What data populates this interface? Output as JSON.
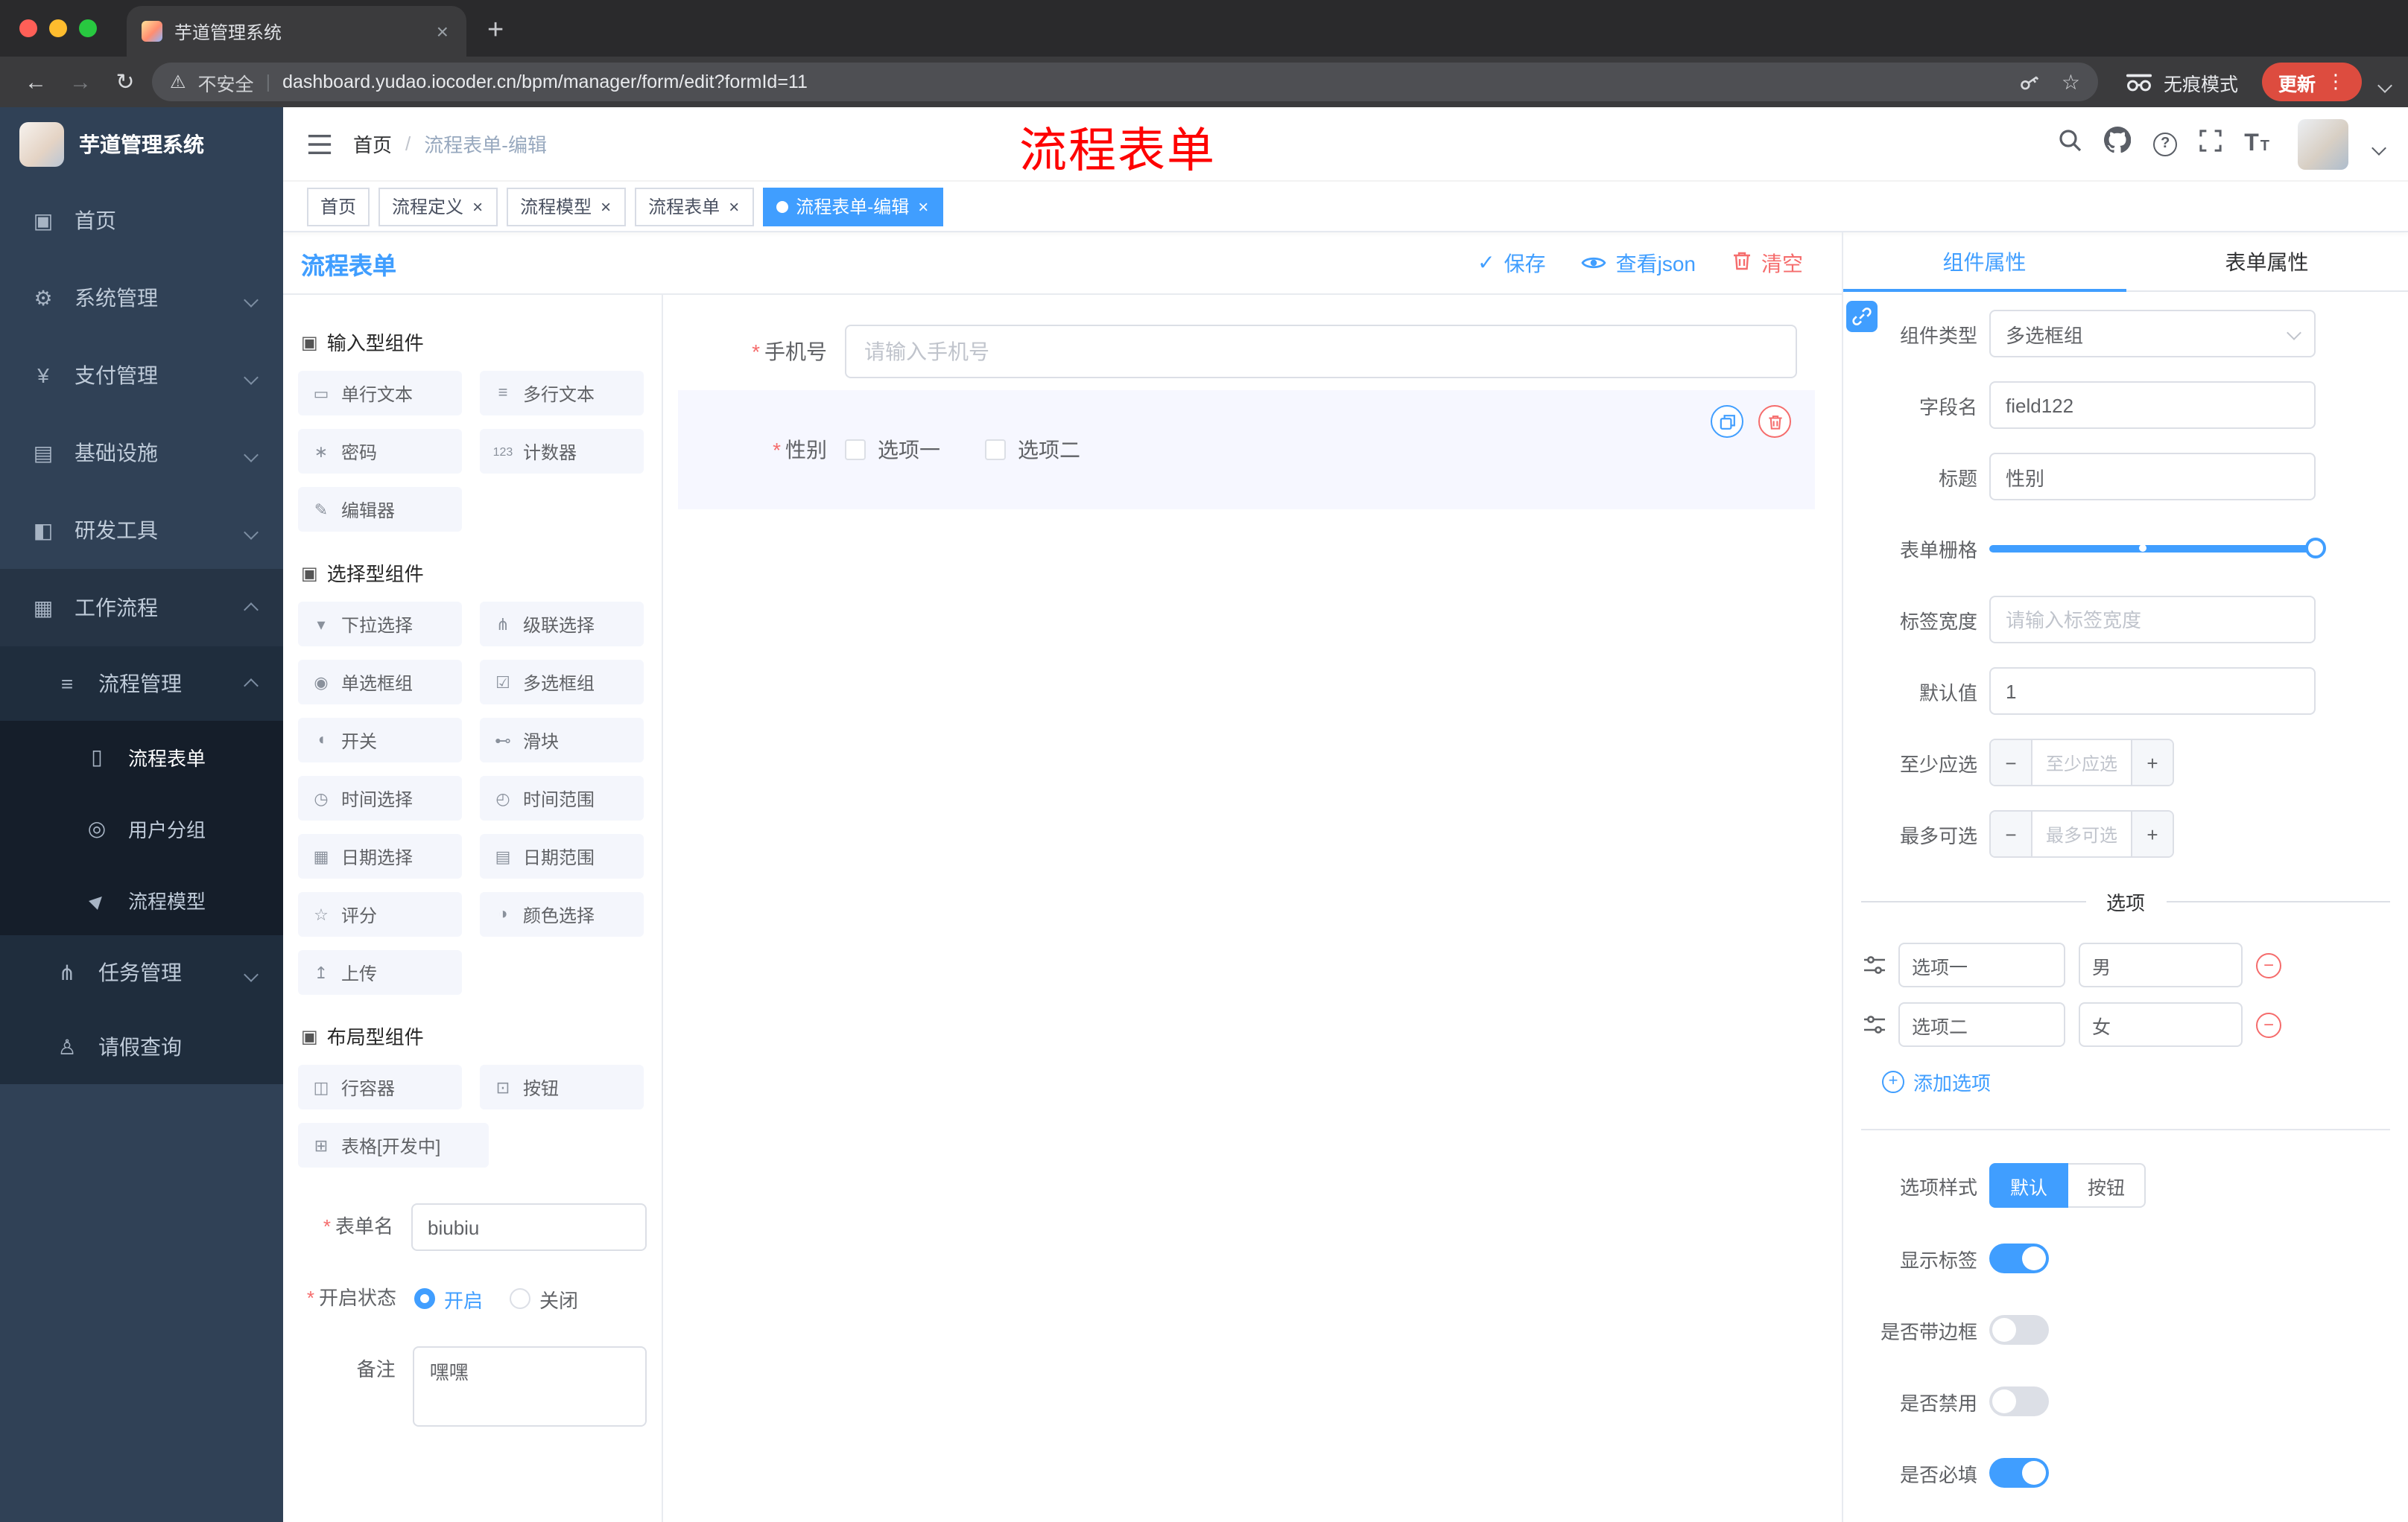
{
  "browser": {
    "tab_title": "芋道管理系统",
    "security_label": "不安全",
    "url": "dashboard.yudao.iocoder.cn/bpm/manager/form/edit?formId=11",
    "incognito_label": "无痕模式",
    "update_label": "更新"
  },
  "icons": {
    "close": "×",
    "new_tab": "+",
    "back": "←",
    "forward": "→",
    "reload": "↻",
    "warning": "⚠",
    "url_divider": "|",
    "star": "☆",
    "kebab": "⋮",
    "question": "?",
    "breadcrumb_sep": "/",
    "check": "✓",
    "required": "*",
    "minus": "−",
    "plus": "+",
    "t_large": "T",
    "t_small": "T"
  },
  "sidebar": {
    "title": "芋道管理系统",
    "items": [
      {
        "icon": "▣",
        "label": "首页"
      },
      {
        "icon": "⚙",
        "label": "系统管理"
      },
      {
        "icon": "¥",
        "label": "支付管理"
      },
      {
        "icon": "▤",
        "label": "基础设施"
      },
      {
        "icon": "◧",
        "label": "研发工具"
      },
      {
        "icon": "▦",
        "label": "工作流程"
      }
    ],
    "process_group": {
      "icon": "≡",
      "label": "流程管理"
    },
    "process_children": [
      {
        "icon": "▯",
        "label": "流程表单"
      },
      {
        "icon": "◎",
        "label": "用户分组"
      },
      {
        "icon": "▶",
        "label": "流程模型"
      }
    ],
    "task_item": {
      "icon": "⋔",
      "label": "任务管理"
    },
    "leave_item": {
      "icon": "♙",
      "label": "请假查询"
    }
  },
  "header": {
    "breadcrumb": [
      "首页",
      "流程表单-编辑"
    ],
    "annotation": "流程表单"
  },
  "tags": [
    {
      "label": "首页"
    },
    {
      "label": "流程定义"
    },
    {
      "label": "流程模型"
    },
    {
      "label": "流程表单"
    },
    {
      "label": "流程表单-编辑"
    }
  ],
  "builder": {
    "title": "流程表单",
    "save": "保存",
    "view_json": "查看json",
    "clear": "清空"
  },
  "palette": {
    "groups": [
      {
        "title": "输入型组件",
        "items": [
          {
            "icon": "▭",
            "label": "单行文本"
          },
          {
            "icon": "≡",
            "label": "多行文本"
          },
          {
            "icon": "∗",
            "label": "密码"
          },
          {
            "icon": "123",
            "label": "计数器"
          },
          {
            "icon": "✎",
            "label": "编辑器"
          }
        ]
      },
      {
        "title": "选择型组件",
        "items": [
          {
            "icon": "▾",
            "label": "下拉选择"
          },
          {
            "icon": "⋔",
            "label": "级联选择"
          },
          {
            "icon": "◉",
            "label": "单选框组"
          },
          {
            "icon": "☑",
            "label": "多选框组"
          },
          {
            "icon": "◖",
            "label": "开关"
          },
          {
            "icon": "⊷",
            "label": "滑块"
          },
          {
            "icon": "◷",
            "label": "时间选择"
          },
          {
            "icon": "◴",
            "label": "时间范围"
          },
          {
            "icon": "▦",
            "label": "日期选择"
          },
          {
            "icon": "▤",
            "label": "日期范围"
          },
          {
            "icon": "☆",
            "label": "评分"
          },
          {
            "icon": "◑",
            "label": "颜色选择"
          },
          {
            "icon": "↥",
            "label": "上传"
          }
        ]
      },
      {
        "title": "布局型组件",
        "items": [
          {
            "icon": "◫",
            "label": "行容器"
          },
          {
            "icon": "⊡",
            "label": "按钮"
          },
          {
            "icon": "⊞",
            "label": "表格[开发中]"
          }
        ]
      }
    ]
  },
  "meta_form": {
    "name_label": "表单名",
    "name_value": "biubiu",
    "status_label": "开启状态",
    "status_on": "开启",
    "status_off": "关闭",
    "remark_label": "备注",
    "remark_value": "嘿嘿"
  },
  "canvas": {
    "phone_label": "手机号",
    "phone_placeholder": "请输入手机号",
    "gender_label": "性别",
    "gender_options": [
      "选项一",
      "选项二"
    ]
  },
  "props": {
    "tabs": [
      "组件属性",
      "表单属性"
    ],
    "component_type_label": "组件类型",
    "component_type_value": "多选框组",
    "field_name_label": "字段名",
    "field_name_value": "field122",
    "title_label": "标题",
    "title_value": "性别",
    "grid_label": "表单栅格",
    "label_width_label": "标签宽度",
    "label_width_placeholder": "请输入标签宽度",
    "default_label": "默认值",
    "default_value": "1",
    "min_label": "至少应选",
    "min_placeholder": "至少应选",
    "max_label": "最多可选",
    "max_placeholder": "最多可选",
    "options_title": "选项",
    "options": [
      {
        "label": "选项一",
        "value": "男"
      },
      {
        "label": "选项二",
        "value": "女"
      }
    ],
    "add_option": "添加选项",
    "style_label": "选项样式",
    "style_default": "默认",
    "style_button": "按钮",
    "switches": [
      {
        "label": "显示标签",
        "on": true
      },
      {
        "label": "是否带边框",
        "on": false
      },
      {
        "label": "是否禁用",
        "on": false
      },
      {
        "label": "是否必填",
        "on": true
      }
    ]
  },
  "colors": {
    "accent": "#409eff",
    "danger": "#f56c6c",
    "annotation": "#fe0100"
  }
}
